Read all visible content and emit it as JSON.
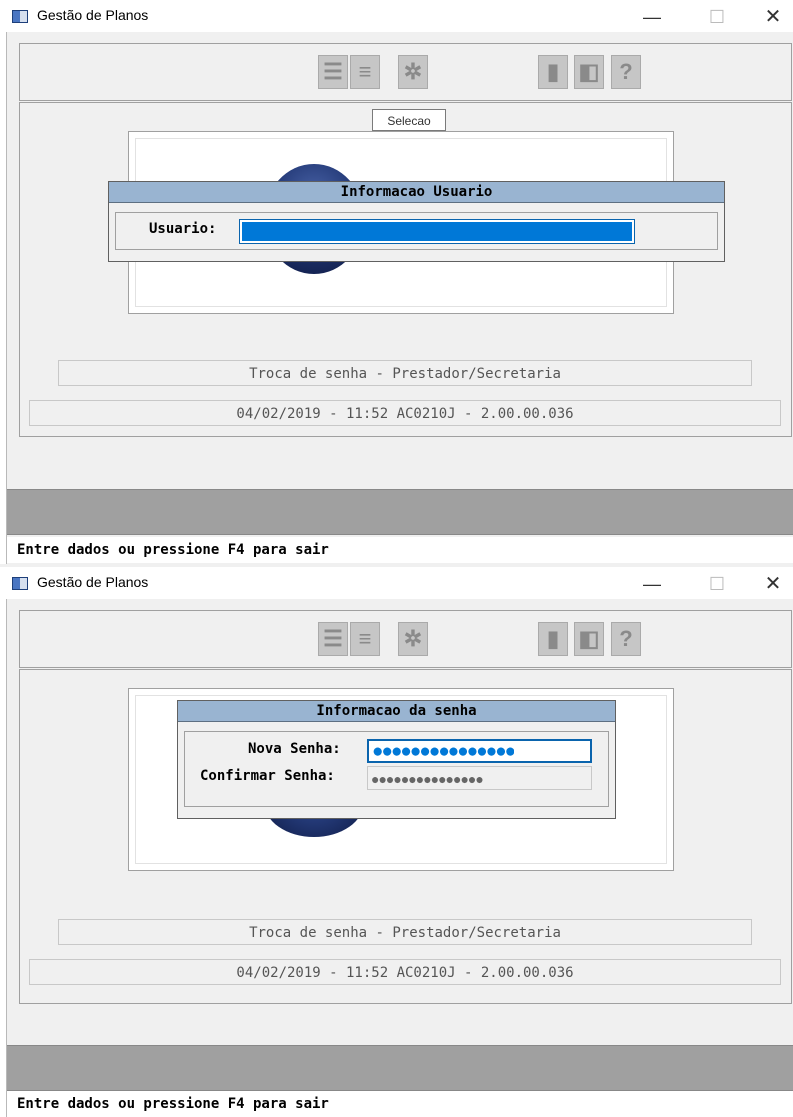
{
  "windows": [
    {
      "title": "Gestão de Planos",
      "controls": {
        "minimize": "—",
        "maximize": "☐",
        "close": "✕"
      },
      "tooltip": "Selecao",
      "dialog": {
        "title": "Informacao Usuario",
        "usuario_label": "Usuario:"
      },
      "subtitle": "Troca de senha - Prestador/Secretaria",
      "version_line": "04/02/2019 - 11:52  AC0210J - 2.00.00.036",
      "status": "Entre dados ou pressione F4 para sair"
    },
    {
      "title": "Gestão de Planos",
      "controls": {
        "minimize": "—",
        "maximize": "☐",
        "close": "✕"
      },
      "dialog": {
        "title": "Informacao da senha",
        "nova_senha_label": "Nova Senha:",
        "confirmar_senha_label": "Confirmar Senha:",
        "nova_senha_mask": "●●●●●●●●●●●●●●●",
        "confirmar_senha_mask": "●●●●●●●●●●●●●●●"
      },
      "subtitle": "Troca de senha - Prestador/Secretaria",
      "version_line": "04/02/2019 - 11:52  AC0210J - 2.00.00.036",
      "status": "Entre dados ou pressione F4 para sair"
    }
  ],
  "toolbar_icons": [
    "select-list-icon",
    "list-icon",
    "settings-gear-icon",
    "exit-icon",
    "door-icon",
    "help-icon"
  ],
  "colors": {
    "dialog_header": "#99b4d1",
    "selection_blue": "#0078d7",
    "status_gray": "#a0a0a0"
  }
}
